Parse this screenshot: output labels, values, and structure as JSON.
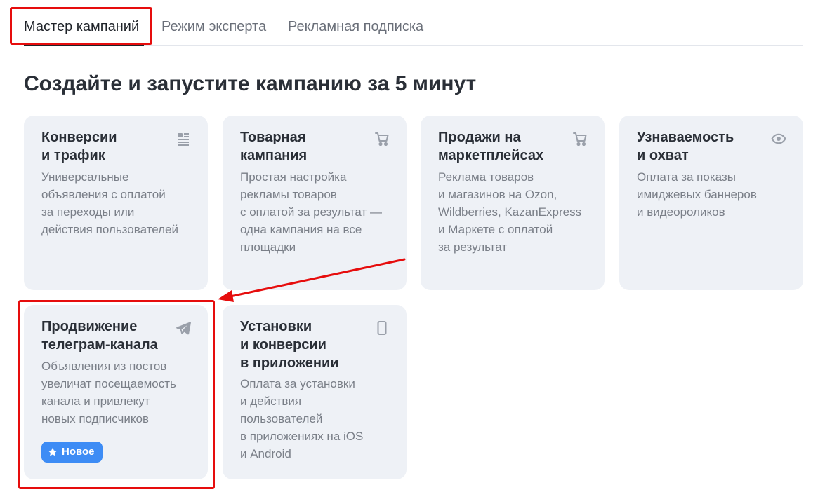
{
  "tabs": [
    {
      "label": "Мастер кампаний",
      "active": true
    },
    {
      "label": "Режим эксперта",
      "active": false
    },
    {
      "label": "Рекламная подписка",
      "active": false
    }
  ],
  "heading": "Создайте и запустите кампанию за 5 минут",
  "cards": [
    {
      "title": "Конверсии\nи трафик",
      "description": "Универсальные\nобъявления с оплатой\nза переходы или\nдействия пользователей",
      "icon": "list-icon"
    },
    {
      "title": "Товарная\nкампания",
      "description": "Простая настройка\nрекламы товаров\nс оплатой за результат —\nодна кампания на все\nплощадки",
      "icon": "cart-icon"
    },
    {
      "title": "Продажи на\nмаркетплейсах",
      "description": "Реклама товаров\nи магазинов на Ozon,\nWildberries, KazanExpress\nи Маркете с оплатой\nза результат",
      "icon": "cart-icon"
    },
    {
      "title": "Узнаваемость\nи охват",
      "description": "Оплата за показы\nимиджевых баннеров\nи видеороликов",
      "icon": "eye-icon"
    },
    {
      "title": "Продвижение\nтелеграм-канала",
      "description": "Объявления из постов\nувеличат посещаемость\nканала и привлекут\nновых подписчиков",
      "icon": "telegram-plane-icon",
      "badge": "Новое"
    },
    {
      "title": "Установки\nи конверсии\nв приложении",
      "description": "Оплата за установки\nи действия\nпользователей\nв приложениях на iOS\nи Android",
      "icon": "phone-icon"
    }
  ],
  "colors": {
    "annotation": "#e60d0d",
    "badge": "#3d8cf5",
    "card_bg": "#eef1f6"
  }
}
